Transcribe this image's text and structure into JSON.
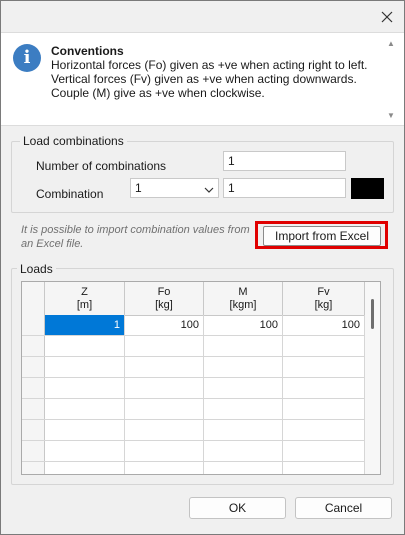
{
  "window": {
    "close_icon": "close-icon"
  },
  "conventions": {
    "icon": "info-icon",
    "icon_glyph": "i",
    "title": "Conventions",
    "lines": [
      "Horizontal forces (Fo) given as +ve when acting right to left.",
      "Vertical forces (Fv) given as +ve when acting downwards.",
      "Couple (M) give as +ve when clockwise."
    ]
  },
  "load_combinations": {
    "legend": "Load combinations",
    "number_label": "Number of combinations",
    "number_value": "1",
    "combination_label": "Combination",
    "combination_selected": "1",
    "combination_name": "1",
    "color": "#000000"
  },
  "import": {
    "note_line1": "It is possible to import combination values from",
    "note_line2": "an Excel file.",
    "button_label": "Import from Excel",
    "highlight_color": "#e00000"
  },
  "loads": {
    "legend": "Loads",
    "columns": [
      {
        "name": "Z",
        "unit": "[m]"
      },
      {
        "name": "Fo",
        "unit": "[kg]"
      },
      {
        "name": "M",
        "unit": "[kgm]"
      },
      {
        "name": "Fv",
        "unit": "[kg]"
      }
    ],
    "rows": [
      [
        "1",
        "100",
        "100",
        "100"
      ]
    ]
  },
  "footer": {
    "ok_label": "OK",
    "cancel_label": "Cancel"
  },
  "colors": {
    "selection": "#0078d7",
    "info_icon": "#3c7dc2"
  }
}
